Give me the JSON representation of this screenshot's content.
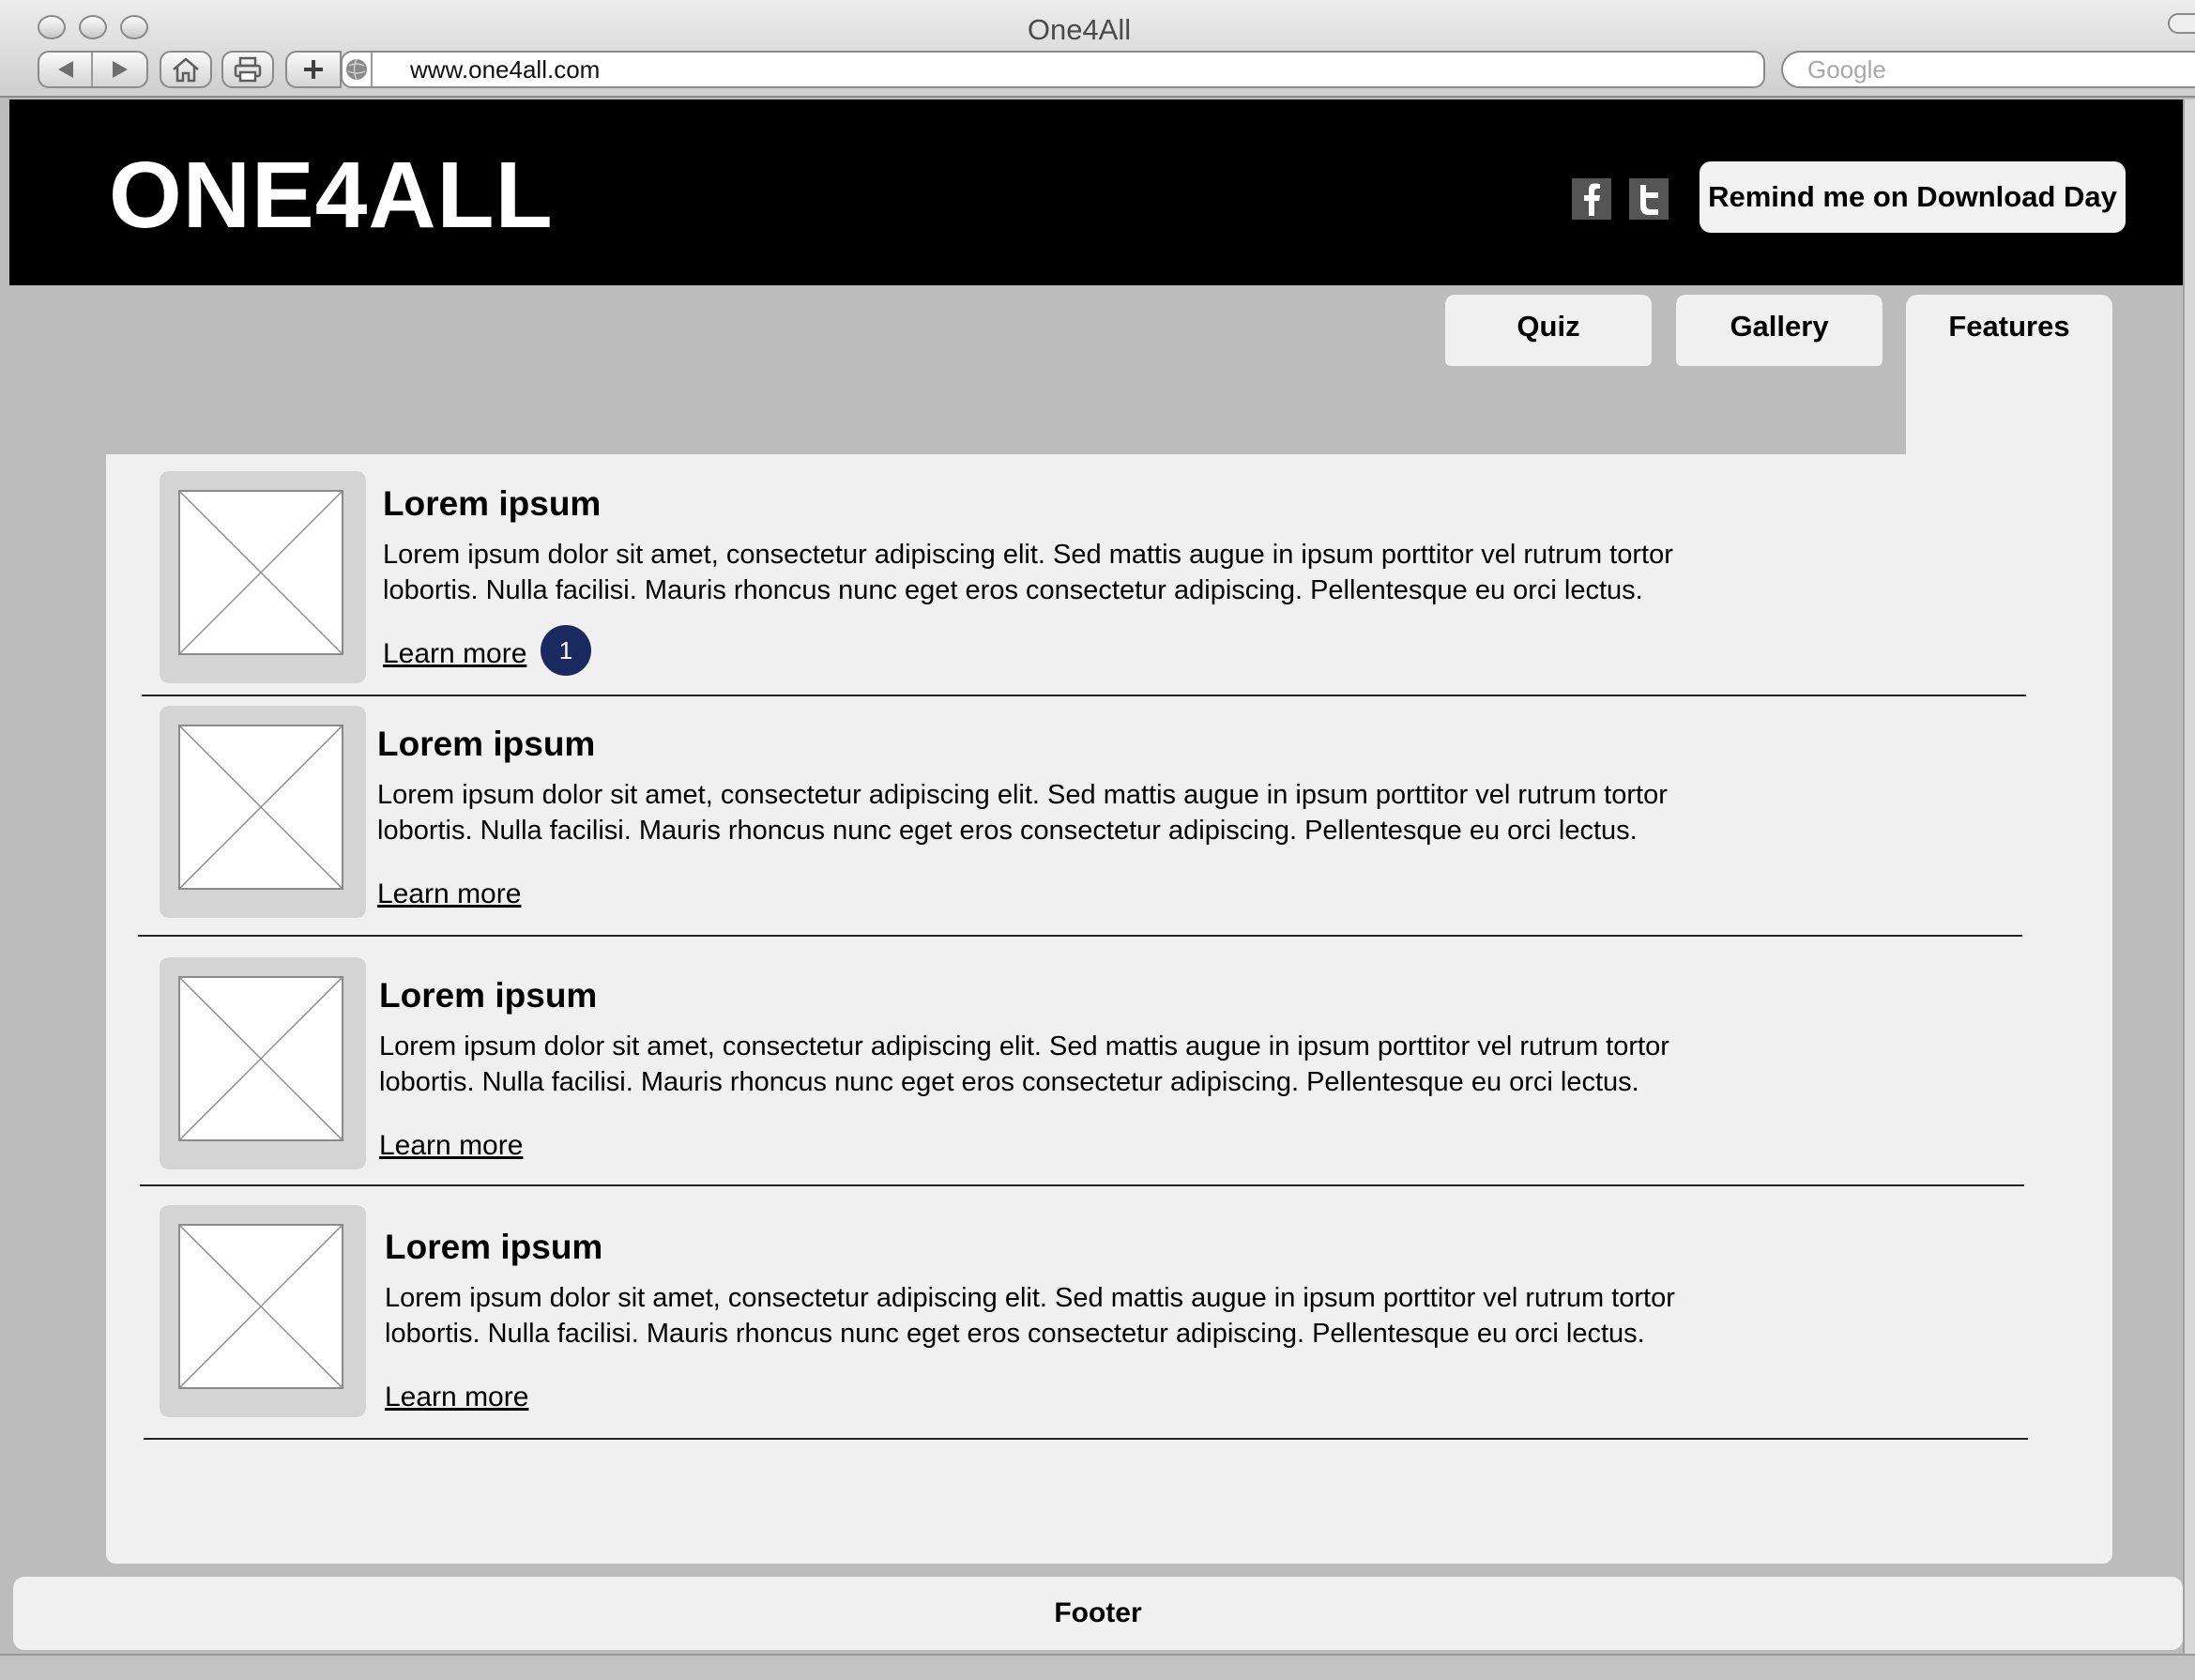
{
  "browser": {
    "window_title": "One4All",
    "url": "www.one4all.com",
    "search_placeholder": "Google"
  },
  "header": {
    "logo": "ONE4ALL",
    "social": {
      "facebook_glyph": "f",
      "twitter_glyph": "t"
    },
    "remind_button": "Remind me on Download Day"
  },
  "tabs": [
    {
      "label": "Quiz",
      "active": false
    },
    {
      "label": "Gallery",
      "active": false
    },
    {
      "label": "Features",
      "active": true
    }
  ],
  "items": [
    {
      "heading": "Lorem ipsum",
      "description": "Lorem ipsum dolor sit amet, consectetur adipiscing elit. Sed mattis augue in ipsum porttitor vel rutrum tortor lobortis. Nulla facilisi. Mauris rhoncus nunc eget eros consectetur adipiscing. Pellentesque eu orci lectus.",
      "link": "Learn more",
      "badge": "1"
    },
    {
      "heading": "Lorem ipsum",
      "description": "Lorem ipsum dolor sit amet, consectetur adipiscing elit. Sed mattis augue in ipsum porttitor vel rutrum tortor lobortis. Nulla facilisi. Mauris rhoncus nunc eget eros consectetur adipiscing. Pellentesque eu orci lectus.",
      "link": "Learn more"
    },
    {
      "heading": "Lorem ipsum",
      "description": "Lorem ipsum dolor sit amet, consectetur adipiscing elit. Sed mattis augue in ipsum porttitor vel rutrum tortor lobortis. Nulla facilisi. Mauris rhoncus nunc eget eros consectetur adipiscing. Pellentesque eu orci lectus.",
      "link": "Learn more"
    },
    {
      "heading": "Lorem ipsum",
      "description": "Lorem ipsum dolor sit amet, consectetur adipiscing elit. Sed mattis augue in ipsum porttitor vel rutrum tortor lobortis. Nulla facilisi. Mauris rhoncus nunc eget eros consectetur adipiscing. Pellentesque eu orci lectus.",
      "link": "Learn more"
    }
  ],
  "footer": {
    "label": "Footer"
  },
  "colors": {
    "header_bg": "#000000",
    "page_bg": "#bcbcbc",
    "panel_bg": "#f0f0f0",
    "badge_bg": "#1b2a5e"
  }
}
